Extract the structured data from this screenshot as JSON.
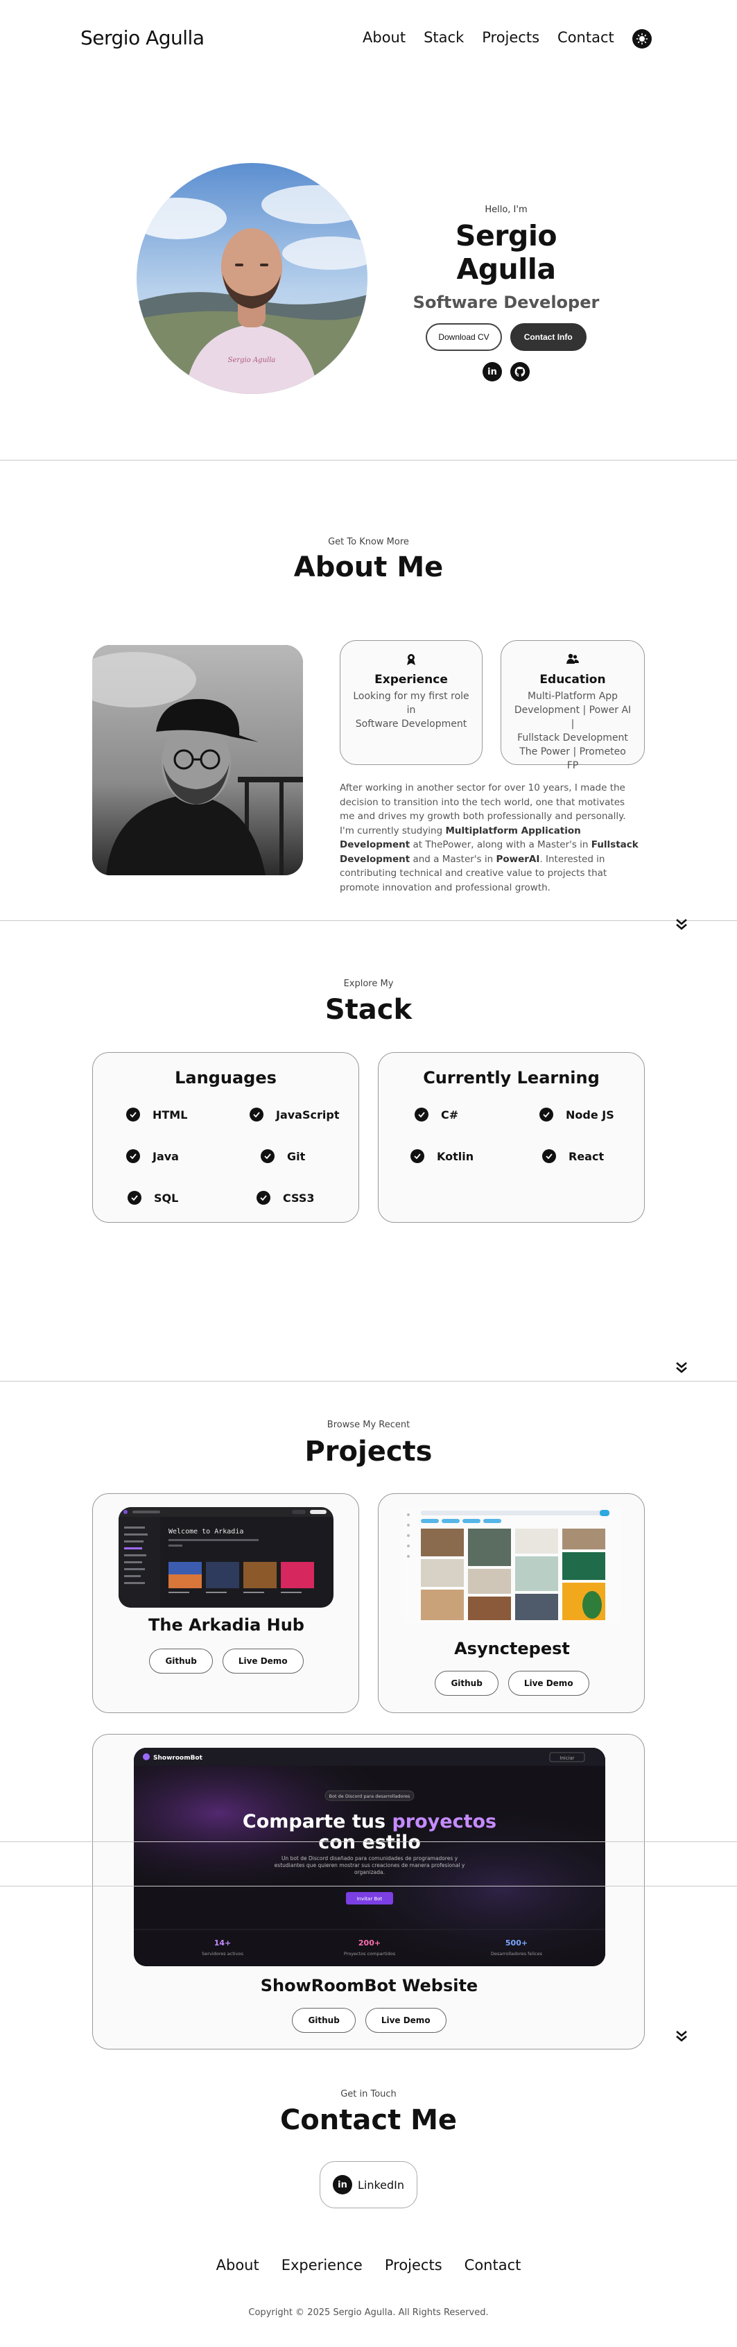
{
  "nav": {
    "logo": "Sergio Agulla",
    "links": [
      "About",
      "Stack",
      "Projects",
      "Contact"
    ],
    "theme_icon": "sun-icon"
  },
  "hero": {
    "greeting": "Hello, I'm",
    "name": "Sergio Agulla",
    "role": "Software Developer",
    "download_cv": "Download CV",
    "contact_info": "Contact Info",
    "socials": [
      "linkedin-icon",
      "github-icon"
    ],
    "shirt_text": "Sergio Agulla"
  },
  "about": {
    "subtitle": "Get To Know More",
    "title": "About Me",
    "experience": {
      "title": "Experience",
      "lines": [
        "Looking for my first role",
        "in",
        "Software Development"
      ]
    },
    "education": {
      "title": "Education",
      "lines": [
        "Multi-Platform App",
        "Development | Power AI |",
        "Fullstack Development",
        "The Power | Prometeo FP"
      ]
    },
    "paragraph": {
      "t1": "After working in another sector for over 10 years, I made the decision to transition into the tech world, one that motivates me and drives my growth both professionally and personally. I'm currently studying ",
      "b1": "Multiplatform Application Development",
      "t2": " at ThePower, along with a Master's in ",
      "b2": "Fullstack Development",
      "t3": " and a Master's in ",
      "b3": "PowerAI",
      "t4": ". Interested in contributing technical and creative value to projects that promote innovation and professional growth."
    }
  },
  "stack": {
    "subtitle": "Explore My",
    "title": "Stack",
    "languages": {
      "title": "Languages",
      "items": [
        "HTML",
        "JavaScript",
        "Java",
        "Git",
        "SQL",
        "CSS3"
      ]
    },
    "learning": {
      "title": "Currently Learning",
      "items": [
        "C#",
        "Node JS",
        "Kotlin",
        "React"
      ]
    }
  },
  "projects": {
    "subtitle": "Browse My Recent",
    "title": "Projects",
    "items": [
      {
        "title": "The Arkadia Hub",
        "github": "Github",
        "demo": "Live Demo",
        "screen_heading": "Welcome to Arkadia"
      },
      {
        "title": "Asynctерest",
        "github": "Github",
        "demo": "Live Demo"
      },
      {
        "title": "ShowRoomBot Website",
        "github": "Github",
        "demo": "Live Demo",
        "brand": "ShowroomBot",
        "badge": "Bot de Discord para desarrolladores",
        "heading_a": "Comparte tus ",
        "heading_b": "proyectos",
        "heading_c": "con estilo",
        "desc": "Un bot de Discord diseñado para comunidades de programadores y estudiantes que quieren mostrar sus creaciones de manera profesional y organizada.",
        "cta": "Invitar Bot",
        "stats": [
          {
            "value": "14+",
            "label": "Servidores activos"
          },
          {
            "value": "200+",
            "label": "Proyectos compartidos"
          },
          {
            "value": "500+",
            "label": "Desarrolladores felices"
          }
        ],
        "login": "Iniciar"
      }
    ]
  },
  "contact": {
    "subtitle": "Get in Touch",
    "title": "Contact Me",
    "linkedin": "LinkedIn"
  },
  "footer": {
    "links": [
      "About",
      "Experience",
      "Projects",
      "Contact"
    ],
    "copyright": "Copyright © 2025 Sergio Agulla. All Rights Reserved."
  }
}
